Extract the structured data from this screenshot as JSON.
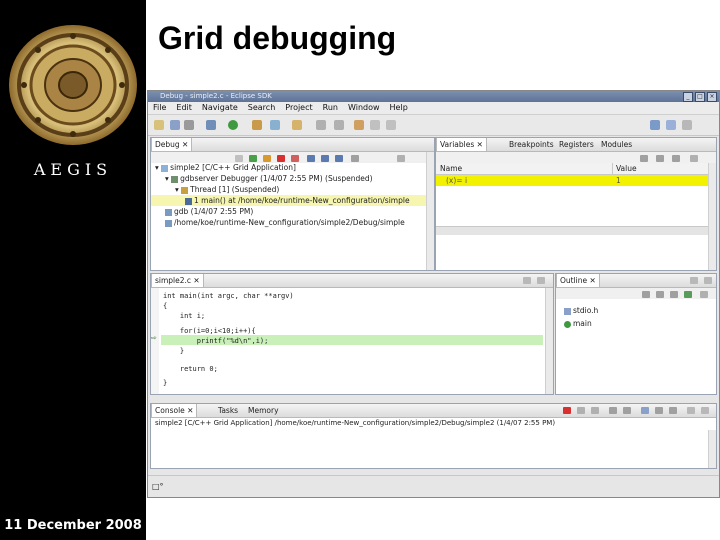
{
  "slide": {
    "title": "Grid debugging",
    "brand": "AEGIS",
    "date": "11 December 2008"
  },
  "window": {
    "title": "Debug - simple2.c - Eclipse SDK",
    "menu": [
      "File",
      "Edit",
      "Navigate",
      "Search",
      "Project",
      "Run",
      "Window",
      "Help"
    ]
  },
  "debug_view": {
    "tab": "Debug",
    "tree": [
      "simple2 [C/C++ Grid Application]",
      "gdbserver Debugger (1/4/07 2:55 PM) (Suspended)",
      "Thread [1] (Suspended)",
      "1 main() at /home/koe/runtime-New_configuration/simple",
      "gdb (1/4/07 2:55 PM)",
      "/home/koe/runtime-New_configuration/simple2/Debug/simple"
    ]
  },
  "variables_view": {
    "tabs": [
      "Variables",
      "Breakpoints",
      "Registers",
      "Modules"
    ],
    "columns": [
      "Name",
      "Value"
    ],
    "rows": [
      {
        "name": "(x)= i",
        "value": "1"
      }
    ]
  },
  "editor": {
    "tab": "simple2.c",
    "lines": [
      "int main(int argc, char **argv)",
      "{",
      "    int i;",
      "",
      "    for(i=0;i<10;i++){",
      "        printf(\"%d\\n\",i);",
      "    }",
      "",
      "    return 0;",
      "}"
    ]
  },
  "outline": {
    "tab": "Outline",
    "items": [
      "stdio.h",
      "main"
    ]
  },
  "console": {
    "tabs": [
      "Console",
      "Tasks",
      "Memory"
    ],
    "text": "simple2 [C/C++ Grid Application] /home/koe/runtime-New_configuration/simple2/Debug/simple2 (1/4/07 2:55 PM)"
  },
  "status": {
    "text": "□°"
  }
}
